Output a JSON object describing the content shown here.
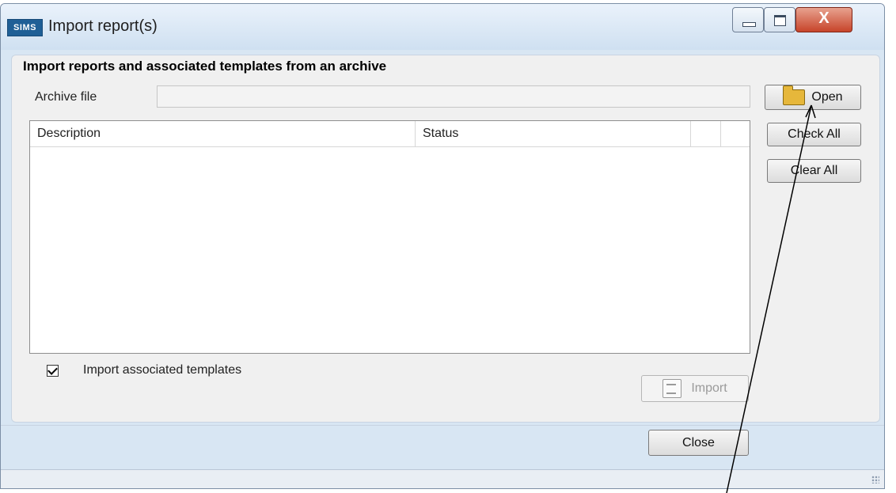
{
  "window": {
    "app_badge": "SIMS",
    "title": "Import report(s)",
    "controls": {
      "minimize": "minimize",
      "maximize": "maximize",
      "close_glyph": "X"
    }
  },
  "panel": {
    "heading": "Import reports and associated templates from an archive",
    "archive_label": "Archive file",
    "archive_value": ""
  },
  "buttons": {
    "open": "Open",
    "check_all": "Check All",
    "clear_all": "Clear All",
    "import": "Import",
    "close": "Close"
  },
  "table": {
    "columns": [
      "Description",
      "Status",
      ""
    ],
    "rows": []
  },
  "options": {
    "import_templates_label": "Import associated templates",
    "import_templates_checked": true
  },
  "icons": {
    "open": "folder-open-icon",
    "import": "import-icon",
    "check": "checkmark-icon"
  },
  "colors": {
    "title_gradient_top": "#eaf2fb",
    "panel_bg": "#f0f0f0",
    "close_red": "#c7442a",
    "app_badge_blue": "#1f5f96"
  }
}
